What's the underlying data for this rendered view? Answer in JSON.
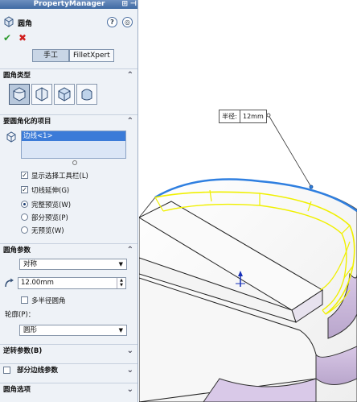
{
  "panel": {
    "title": "PropertyManager",
    "feature_name": "圆角",
    "tabs": [
      "手工",
      "FilletXpert"
    ],
    "fillet_type_header": "圆角类型",
    "items_header": "要圆角化的项目",
    "edge_item": "边线<1>",
    "options": {
      "show_toolbar": "显示选择工具栏(L)",
      "tangent_propagation": "切线延伸(G)",
      "full_preview": "完整预览(W)",
      "partial_preview": "部分预览(P)",
      "no_preview": "无预览(W)"
    },
    "params_header": "圆角参数",
    "symmetric": "对称",
    "radius_value": "12.00mm",
    "multi_radius": "多半径圆角",
    "profile_label": "轮廓(P)：",
    "profile_value": "圆形",
    "setback_header": "逆转参数(B)",
    "partial_edge_header": "部分边线参数",
    "fillet_options_header": "圆角选项"
  },
  "viewport": {
    "dimension_key": "半径:",
    "dimension_value": "12mm"
  },
  "colors": {
    "selection_yellow": "#f0f000",
    "edge_blue": "#2f7fe0",
    "body_purple": "#c9b8d8"
  }
}
